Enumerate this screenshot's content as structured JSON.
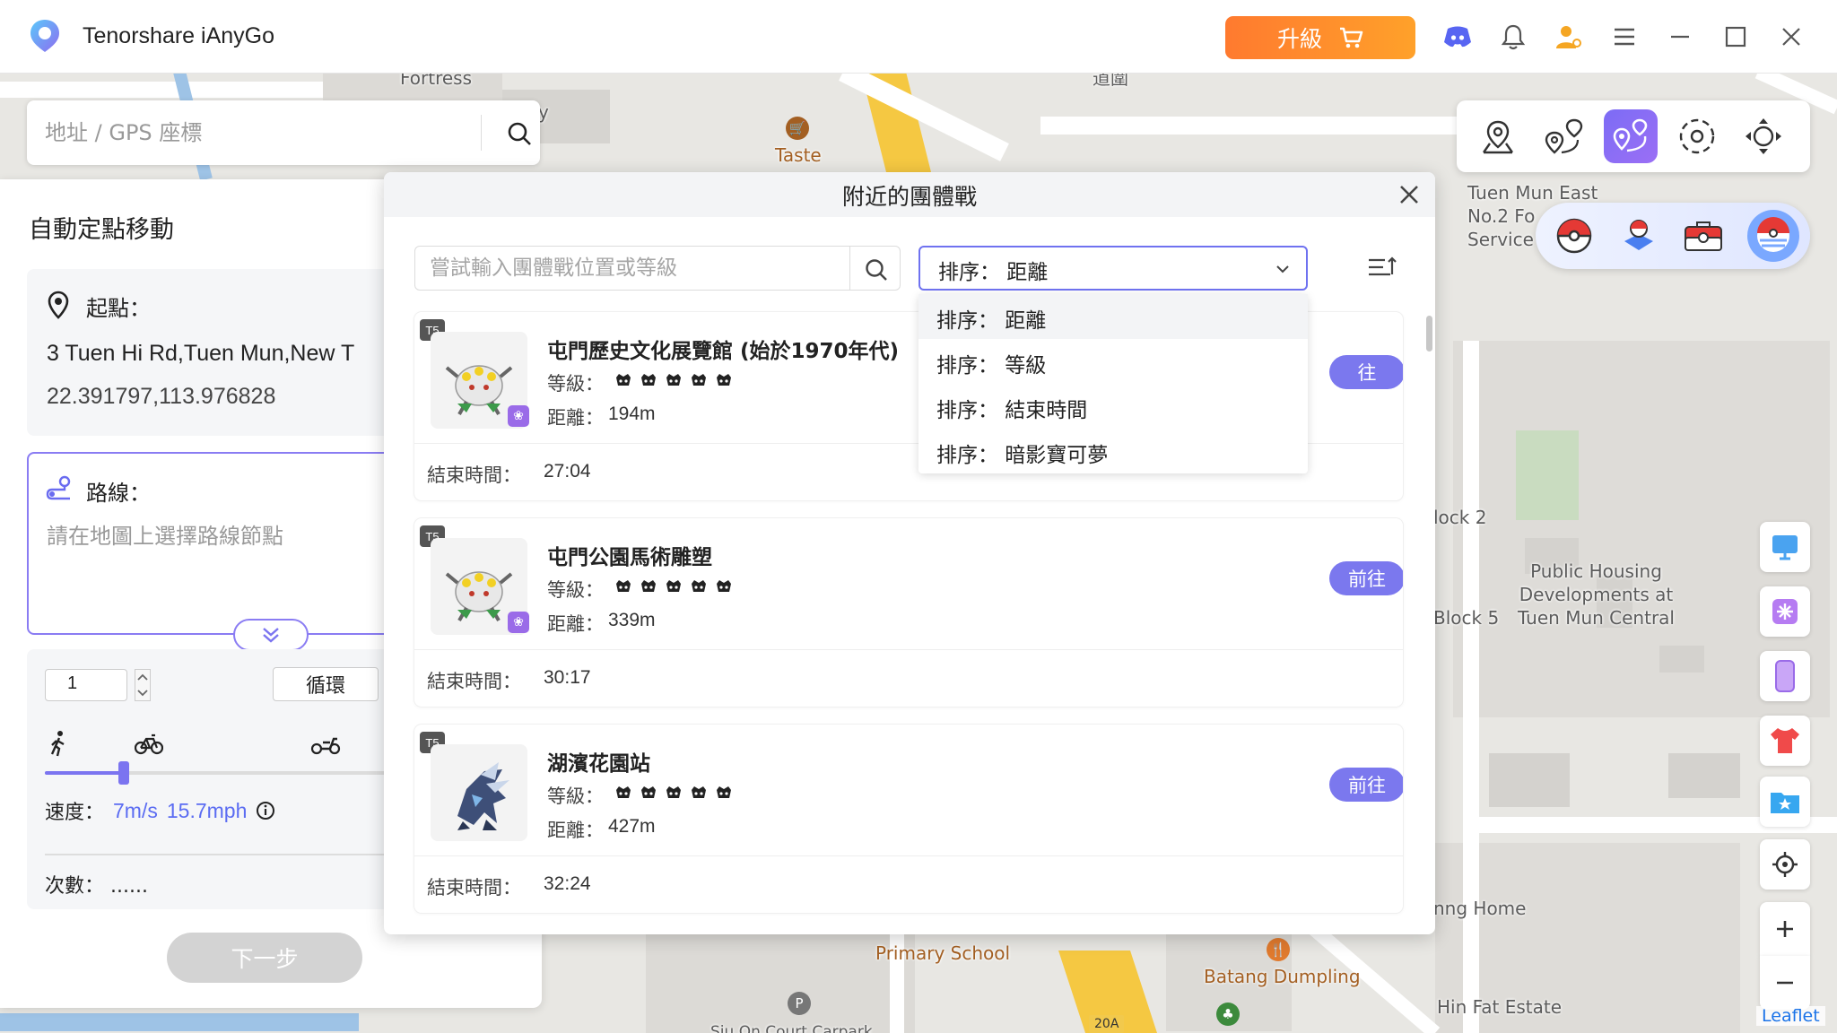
{
  "app": {
    "title": "Tenorshare iAnyGo",
    "upgrade_label": "升級"
  },
  "colors": {
    "accent": "#7b78ee",
    "upgrade": "#ff8a2b",
    "route_border": "#8a7cf3"
  },
  "search": {
    "placeholder": "地址 / GPS 座標"
  },
  "map_labels": {
    "fortress": "Fortress",
    "daowei": "道圍",
    "taste": "Taste",
    "tuen_mun_east": "Tuen Mun East\nNo.2 Fo\nService",
    "block2": "lock 2",
    "block5": "Block 5",
    "public_housing": "Public Housing\nDevelopments at\nTuen Mun Central",
    "home": "nng Home",
    "primary_school": "Primary School",
    "batang": "Batang Dumpling",
    "hin_fat": "Hin Fat Estate",
    "carpark": "Siu On Court Carpark",
    "road_20a": "20A",
    "y_fragment": "y"
  },
  "left_panel": {
    "title": "自動定點移動",
    "start_label": "起點：",
    "start_address": "3 Tuen Hi Rd,Tuen Mun,New T",
    "start_coords": "22.391797,113.976828",
    "route_label": "路線：",
    "route_hint": "請在地圖上選擇路線節點",
    "loop_count": "1",
    "loop_label": "循環",
    "speed_label": "速度：",
    "speed_ms": "7m/s",
    "speed_mph": "15.7mph",
    "speed_fraction": 0.17,
    "count_label": "次數：",
    "count_value": "......",
    "next_label": "下一步"
  },
  "dialog": {
    "title": "附近的團體戰",
    "search_placeholder": "嘗試輸入團體戰位置或等級",
    "sort_value": "排序：  距離",
    "sort_options": [
      "排序：  距離",
      "排序：  等級",
      "排序：  結束時間",
      "排序：  暗影寶可夢"
    ],
    "level_label": "等級：",
    "distance_label": "距離：",
    "end_time_label": "結束時間：",
    "go_label": "前往",
    "raids": [
      {
        "tier": "T5",
        "name": "屯門歷史文化展覽館 (始於1970年代)",
        "distance": "194m",
        "end_time": "27:04",
        "go_visible": "往"
      },
      {
        "tier": "T5",
        "name": "屯門公園馬術雕塑",
        "distance": "339m",
        "end_time": "30:17"
      },
      {
        "tier": "T5",
        "name": "湖濱花園站",
        "distance": "427m",
        "end_time": "32:24"
      }
    ]
  },
  "leaflet": "Leaflet"
}
